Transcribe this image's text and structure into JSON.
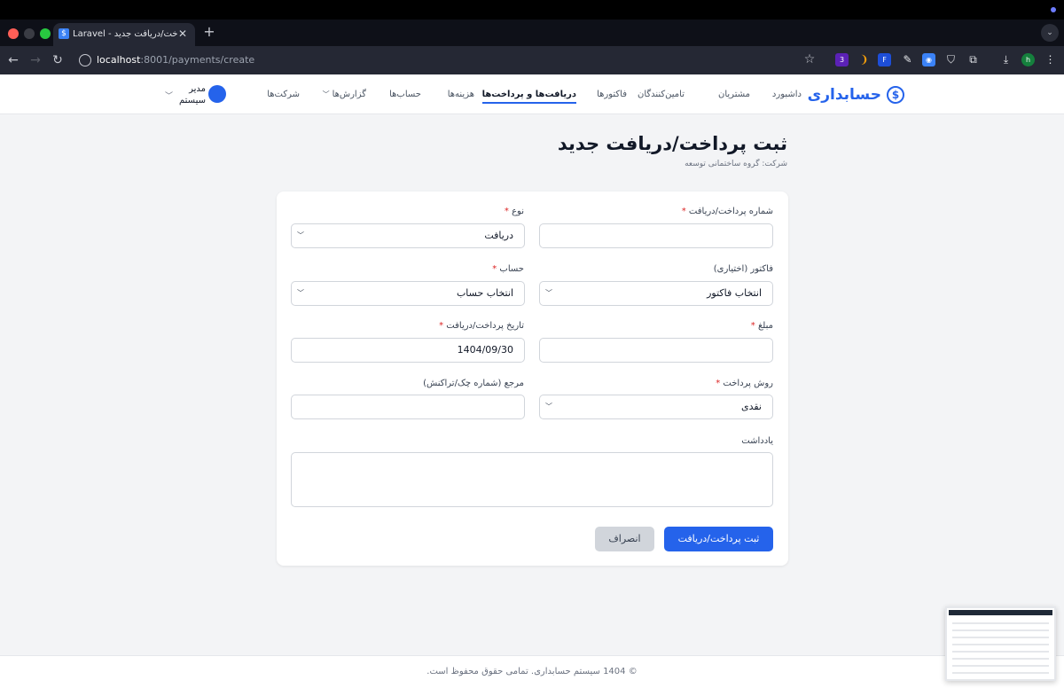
{
  "browser": {
    "tab_title": "Laravel - پرداخت/دریافت جدید",
    "tab_favicon": "$",
    "url_host": "localhost",
    "url_path": ":8001/payments/create",
    "extension_badge": "3",
    "profile_initial": "h"
  },
  "nav": {
    "brand": "حسابداری",
    "brand_icon": "$",
    "items": [
      {
        "label": "داشبورد"
      },
      {
        "label": "مشتریان"
      },
      {
        "label": "تامین‌کنندگان"
      },
      {
        "label": "فاکتورها"
      },
      {
        "label": "دریافت‌ها و پرداخت‌ها",
        "active": true
      },
      {
        "label": "هزینه‌ها"
      },
      {
        "label": "حساب‌ها"
      },
      {
        "label": "گزارش‌ها"
      },
      {
        "label": "شرکت‌ها"
      }
    ],
    "user_name": "مدیر سیستم"
  },
  "page": {
    "title": "ثبت پرداخت/دریافت جدید",
    "subtitle": "شرکت: گروه ساختمانی توسعه"
  },
  "form": {
    "payment_number_label": "شماره پرداخت/دریافت",
    "payment_number_value": "",
    "type_label": "نوع",
    "type_value": "دریافت",
    "invoice_label": "فاکتور (اختیاری)",
    "invoice_value": "انتخاب فاکتور",
    "account_label": "حساب",
    "account_value": "انتخاب حساب",
    "amount_label": "مبلغ",
    "amount_value": "",
    "date_label": "تاریخ پرداخت/دریافت",
    "date_value": "1404/09/30",
    "method_label": "روش پرداخت",
    "method_value": "نقدی",
    "reference_label": "مرجع (شماره چک/تراکنش)",
    "reference_value": "",
    "notes_label": "یادداشت",
    "submit_label": "ثبت پرداخت/دریافت",
    "cancel_label": "انصراف",
    "required_mark": "*"
  },
  "footer": {
    "text": "© 1404 سیستم حسابداری. تمامی حقوق محفوظ است."
  },
  "colors": {
    "primary": "#2563eb",
    "required": "#dc2626",
    "background": "#f3f4f6"
  }
}
